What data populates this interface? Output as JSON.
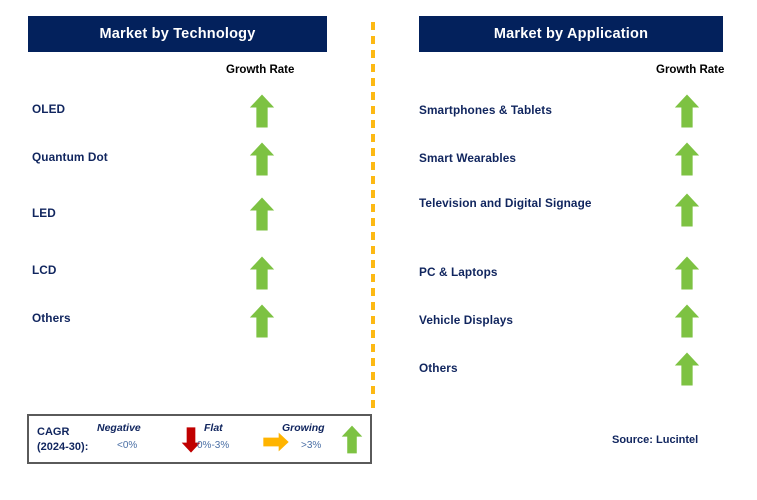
{
  "panels": [
    {
      "id": "technology",
      "title": "Market by Technology",
      "column_header": "Growth Rate",
      "rows": [
        {
          "label": "OLED",
          "trend": "growing",
          "icon": "arrow-up-icon"
        },
        {
          "label": "Quantum Dot",
          "trend": "growing",
          "icon": "arrow-up-icon"
        },
        {
          "label": "LED",
          "trend": "growing",
          "icon": "arrow-up-icon"
        },
        {
          "label": "LCD",
          "trend": "growing",
          "icon": "arrow-up-icon"
        },
        {
          "label": "Others",
          "trend": "growing",
          "icon": "arrow-up-icon"
        }
      ]
    },
    {
      "id": "application",
      "title": "Market by Application",
      "column_header": "Growth Rate",
      "rows": [
        {
          "label": "Smartphones & Tablets",
          "trend": "growing",
          "icon": "arrow-up-icon"
        },
        {
          "label": "Smart Wearables",
          "trend": "growing",
          "icon": "arrow-up-icon"
        },
        {
          "label": "Television and Digital Signage",
          "trend": "growing",
          "icon": "arrow-up-icon"
        },
        {
          "label": "PC & Laptops",
          "trend": "growing",
          "icon": "arrow-up-icon"
        },
        {
          "label": "Vehicle Displays",
          "trend": "growing",
          "icon": "arrow-up-icon"
        },
        {
          "label": "Others",
          "trend": "growing",
          "icon": "arrow-up-icon"
        }
      ]
    }
  ],
  "legend": {
    "title_line1": "CAGR",
    "title_line2": "(2024-30):",
    "entries": [
      {
        "name": "Negative",
        "range": "<0%",
        "icon": "arrow-down-icon",
        "color": "#c00000"
      },
      {
        "name": "Flat",
        "range": "0%-3%",
        "icon": "arrow-right-icon",
        "color": "#ffb400"
      },
      {
        "name": "Growing",
        "range": ">3%",
        "icon": "arrow-up-icon",
        "color": "#7dc242"
      }
    ]
  },
  "source": "Source: Lucintel",
  "colors": {
    "header_navy": "#03215c",
    "text_navy": "#10255e",
    "growth_green": "#7dc242",
    "negative_red": "#c00000",
    "flat_amber": "#ffb400",
    "divider_amber": "#fdb913",
    "legend_border": "#5a5a5a",
    "value_blue": "#4a6fa5"
  }
}
